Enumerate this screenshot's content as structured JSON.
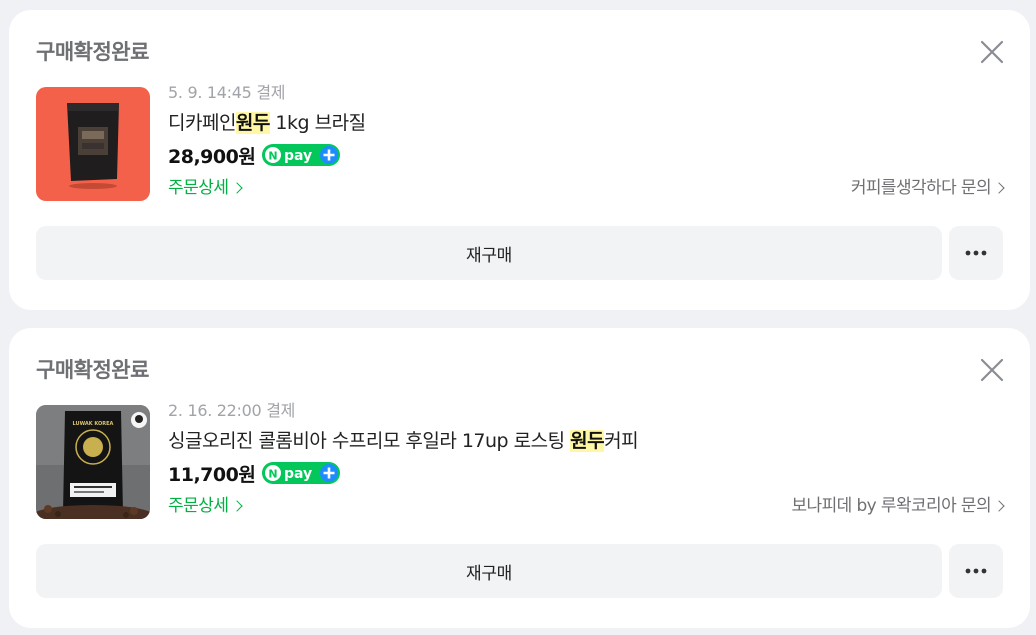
{
  "orders": [
    {
      "status": "구매확정완료",
      "datetime": "5. 9. 14:45",
      "paid_label": "결제",
      "title_before": "디카페인",
      "title_highlight": "원두",
      "title_after": " 1kg 브라질",
      "price": "28,900원",
      "pay_badge": "pay",
      "detail_label": "주문상세",
      "seller_inquiry": "커피를생각하다 문의",
      "rebuy_label": "재구매",
      "thumb_bg": "#f4614a"
    },
    {
      "status": "구매확정완료",
      "datetime": "2. 16. 22:00",
      "paid_label": "결제",
      "title_before": "싱글오리진 콜롬비아 수프리모 후일라 17up 로스팅 ",
      "title_highlight": "원두",
      "title_after": "커피",
      "price": "11,700원",
      "pay_badge": "pay",
      "detail_label": "주문상세",
      "seller_inquiry": "보나피데 by 루왁코리아 문의",
      "rebuy_label": "재구매",
      "thumb_bg": "#6d6f71",
      "thumb_brand": "LUWAK KOREA"
    }
  ],
  "colors": {
    "npay_green": "#03c75a",
    "npay_blue": "#1e8cff",
    "highlight": "#fff7a6",
    "link_green": "#03b043"
  }
}
